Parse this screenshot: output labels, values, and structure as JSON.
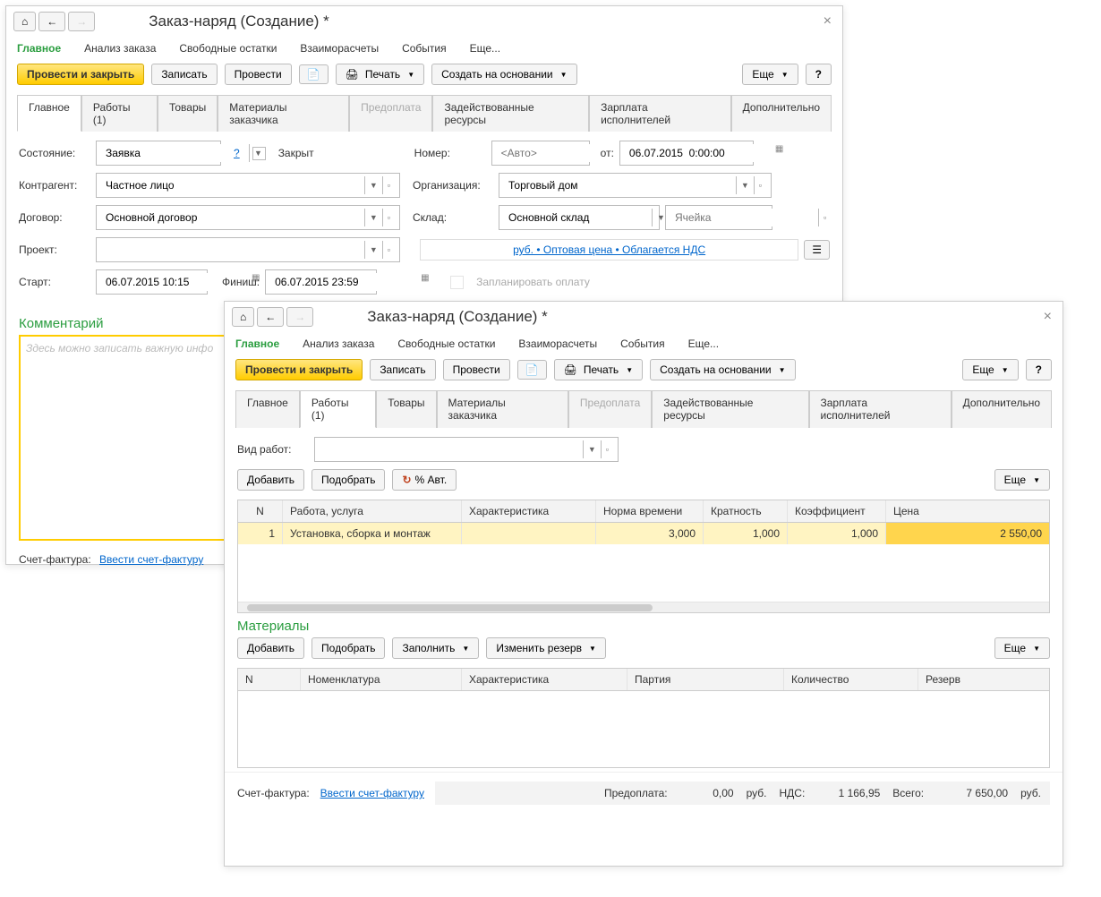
{
  "window1": {
    "title": "Заказ-наряд (Создание) *",
    "nav": {
      "main": "Главное",
      "analysis": "Анализ заказа",
      "remains": "Свободные остатки",
      "settlements": "Взаиморасчеты",
      "events": "События",
      "more": "Еще..."
    },
    "toolbar": {
      "post_close": "Провести и закрыть",
      "write": "Записать",
      "post": "Провести",
      "print": "Печать",
      "create_based": "Создать на основании",
      "more": "Еще",
      "help": "?"
    },
    "tabs": {
      "main": "Главное",
      "works": "Работы (1)",
      "goods": "Товары",
      "materials": "Материалы заказчика",
      "prepay": "Предоплата",
      "resources": "Задействованные ресурсы",
      "salary": "Зарплата исполнителей",
      "extra": "Дополнительно"
    },
    "fields": {
      "state_label": "Состояние:",
      "state_value": "Заявка",
      "help": "?",
      "closed_label": "Закрыт",
      "number_label": "Номер:",
      "number_placeholder": "<Авто>",
      "from_label": "от:",
      "from_value": "06.07.2015  0:00:00",
      "counterparty_label": "Контрагент:",
      "counterparty_value": "Частное лицо",
      "org_label": "Организация:",
      "org_value": "Торговый дом",
      "contract_label": "Договор:",
      "contract_value": "Основной договор",
      "warehouse_label": "Склад:",
      "warehouse_value": "Основной склад",
      "cell_placeholder": "Ячейка",
      "project_label": "Проект:",
      "price_link": "руб. • Оптовая цена • Облагается НДС",
      "start_label": "Старт:",
      "start_value": "06.07.2015 10:15",
      "finish_label": "Финиш:",
      "finish_value": "06.07.2015 23:59",
      "plan_pay": "Запланировать оплату"
    },
    "comment_title": "Комментарий",
    "comment_placeholder": "Здесь можно записать важную инфо",
    "invoice_label": "Счет-фактура:",
    "invoice_link": "Ввести счет-фактуру"
  },
  "window2": {
    "title": "Заказ-наряд (Создание) *",
    "nav": {
      "main": "Главное",
      "analysis": "Анализ заказа",
      "remains": "Свободные остатки",
      "settlements": "Взаиморасчеты",
      "events": "События",
      "more": "Еще..."
    },
    "toolbar": {
      "post_close": "Провести и закрыть",
      "write": "Записать",
      "post": "Провести",
      "print": "Печать",
      "create_based": "Создать на основании",
      "more": "Еще",
      "help": "?"
    },
    "tabs": {
      "main": "Главное",
      "works": "Работы (1)",
      "goods": "Товары",
      "materials": "Материалы заказчика",
      "prepay": "Предоплата",
      "resources": "Задействованные ресурсы",
      "salary": "Зарплата исполнителей",
      "extra": "Дополнительно"
    },
    "work_type_label": "Вид работ:",
    "grid_toolbar": {
      "add": "Добавить",
      "pick": "Подобрать",
      "auto": "% Авт.",
      "more": "Еще"
    },
    "grid": {
      "headers": {
        "n": "N",
        "work": "Работа, услуга",
        "char": "Характеристика",
        "norm": "Норма времени",
        "mult": "Кратность",
        "coef": "Коэффициент",
        "price": "Цена"
      },
      "rows": [
        {
          "n": "1",
          "work": "Установка, сборка и монтаж",
          "char": "",
          "norm": "3,000",
          "mult": "1,000",
          "coef": "1,000",
          "price": "2 550,00"
        }
      ]
    },
    "materials_title": "Материалы",
    "mat_toolbar": {
      "add": "Добавить",
      "pick": "Подобрать",
      "fill": "Заполнить",
      "reserve": "Изменить резерв",
      "more": "Еще"
    },
    "mat_grid": {
      "headers": {
        "n": "N",
        "nom": "Номенклатура",
        "char": "Характеристика",
        "party": "Партия",
        "qty": "Количество",
        "reserve": "Резерв"
      }
    },
    "invoice_label": "Счет-фактура:",
    "invoice_link": "Ввести счет-фактуру",
    "totals": {
      "prepay_label": "Предоплата:",
      "prepay_value": "0,00",
      "currency": "руб.",
      "vat_label": "НДС:",
      "vat_value": "1 166,95",
      "total_label": "Всего:",
      "total_value": "7 650,00"
    }
  }
}
